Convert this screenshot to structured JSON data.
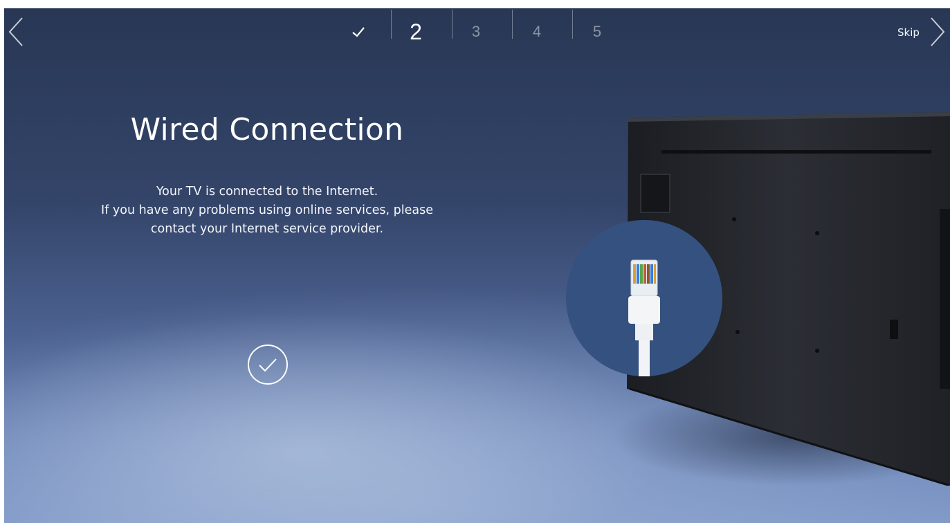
{
  "nav": {
    "back_icon": "chevron-left-icon",
    "forward_icon": "chevron-right-icon",
    "skip_label": "Skip"
  },
  "steps": {
    "completed_icon": "check-icon",
    "items": [
      "2",
      "3",
      "4",
      "5"
    ],
    "current": "2"
  },
  "content": {
    "title": "Wired Connection",
    "description_lines": [
      "Your TV is connected to the Internet.",
      "If you have any problems using online services, please",
      "contact your Internet service provider."
    ],
    "status_icon": "check-circle-icon"
  },
  "illustration": {
    "tv_icon": "tv-rear-panel-illustration",
    "cable_icon": "ethernet-cable-illustration"
  },
  "colors": {
    "background_top": "#283754",
    "background_bottom": "#7f98c7",
    "highlight_circle": "#35517f",
    "text": "#ffffff"
  }
}
